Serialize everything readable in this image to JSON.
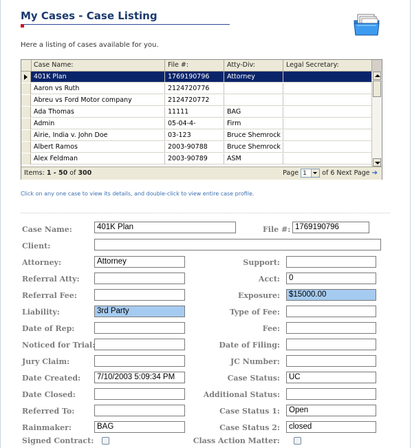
{
  "header": {
    "title": "My Cases - Case Listing",
    "intro": "Here a listing of cases available for you."
  },
  "grid": {
    "columns": [
      "Case Name:",
      "File #:",
      "Atty-Div:",
      "Legal Secretary:"
    ],
    "rows": [
      {
        "case_name": "401K Plan",
        "file_no": "1769190796",
        "atty_div": "Attorney",
        "legal_secretary": "",
        "selected": true
      },
      {
        "case_name": "Aaron vs Ruth",
        "file_no": "2124720776",
        "atty_div": "",
        "legal_secretary": ""
      },
      {
        "case_name": "Abreu vs Ford Motor company",
        "file_no": "2124720772",
        "atty_div": "",
        "legal_secretary": ""
      },
      {
        "case_name": "Ada Thomas",
        "file_no": "11111",
        "atty_div": "BAG",
        "legal_secretary": ""
      },
      {
        "case_name": "Admin",
        "file_no": "05-04-4-",
        "atty_div": "Firm",
        "legal_secretary": ""
      },
      {
        "case_name": "Airie, India v. John Doe",
        "file_no": "03-123",
        "atty_div": "Bruce Shemrock",
        "legal_secretary": ""
      },
      {
        "case_name": "Albert Ramos",
        "file_no": "2003-90788",
        "atty_div": "Bruce Shemrock",
        "legal_secretary": ""
      },
      {
        "case_name": "Alex Feldman",
        "file_no": "2003-90789",
        "atty_div": "ASM",
        "legal_secretary": ""
      }
    ],
    "footer": {
      "items_prefix": "Items:",
      "items_range": "1 - 50",
      "of_label": "of",
      "total": "300",
      "page_label": "Page",
      "page_value": "1",
      "of_pages": "of 6",
      "next_label": "Next Page"
    }
  },
  "hint": "Click on any one case to view its details, and double-click to view entire case profile.",
  "form": {
    "case_name": {
      "label": "Case Name:",
      "value": "401K Plan"
    },
    "file_no": {
      "label": "File #:",
      "value": "1769190796"
    },
    "client": {
      "label": "Client:",
      "value": ""
    },
    "attorney": {
      "label": "Attorney:",
      "value": "Attorney"
    },
    "support": {
      "label": "Support:",
      "value": ""
    },
    "referral_atty": {
      "label": "Referral Atty:",
      "value": ""
    },
    "acct": {
      "label": "Acct:",
      "value": "0"
    },
    "referral_fee": {
      "label": "Referral Fee:",
      "value": ""
    },
    "exposure": {
      "label": "Exposure:",
      "value": "$15000.00"
    },
    "liability": {
      "label": "Liability:",
      "value": "3rd Party"
    },
    "type_of_fee": {
      "label": "Type of Fee:",
      "value": ""
    },
    "date_of_rep": {
      "label": "Date of Rep:",
      "value": ""
    },
    "fee": {
      "label": "Fee:",
      "value": ""
    },
    "noticed_for_trial": {
      "label": "Noticed for Trial:",
      "value": ""
    },
    "date_of_filing": {
      "label": "Date of Filing:",
      "value": ""
    },
    "jury_claim": {
      "label": "Jury Claim:",
      "value": ""
    },
    "jc_number": {
      "label": "JC Number:",
      "value": ""
    },
    "date_created": {
      "label": "Date Created:",
      "value": "7/10/2003 5:09:34 PM"
    },
    "case_status": {
      "label": "Case Status:",
      "value": "UC"
    },
    "date_closed": {
      "label": "Date Closed:",
      "value": ""
    },
    "additional_status": {
      "label": "Additional Status:",
      "value": ""
    },
    "referred_to": {
      "label": "Referred To:",
      "value": ""
    },
    "case_status_1": {
      "label": "Case Status 1:",
      "value": "Open"
    },
    "rainmaker": {
      "label": "Rainmaker:",
      "value": "BAG"
    },
    "case_status_2": {
      "label": "Case Status 2:",
      "value": "closed"
    },
    "signed_contract": {
      "label": "Signed Contract:",
      "checked": false
    },
    "class_action_matter": {
      "label": "Class Action Matter:",
      "checked": false
    }
  },
  "colors": {
    "title": "#1c3a6e",
    "selected_row": "#0a246a",
    "highlight_field": "#a6cbf0",
    "label": "#7d7d7d",
    "hint": "#3a6fb0"
  },
  "icons": {
    "header": "folder-cases-icon",
    "row_indicator": "row-pointer-icon",
    "next_page": "next-arrow-icon"
  }
}
